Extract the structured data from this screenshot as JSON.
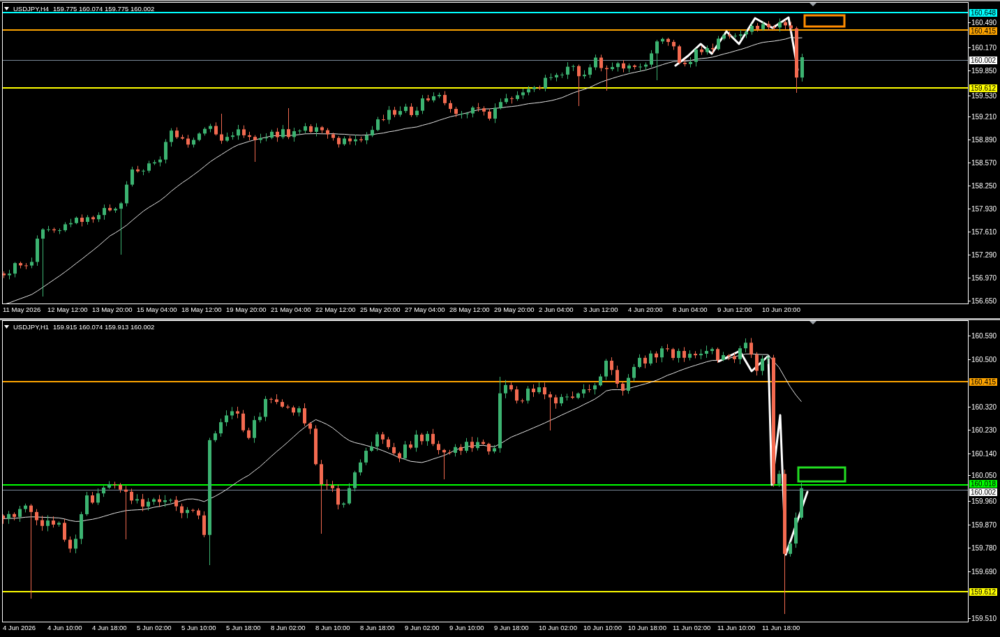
{
  "top_chart": {
    "header": {
      "symbol": "USDJPY,H4",
      "quote": "159.775 160.074 159.775 160.002"
    },
    "price_axis": [
      "160.490",
      "160.170",
      "159.850",
      "159.530",
      "159.210",
      "158.890",
      "158.570",
      "158.250",
      "157.930",
      "157.610",
      "157.290",
      "156.970",
      "156.650"
    ],
    "levels": [
      {
        "kind": "level",
        "price": "160.648",
        "color": "#00ffff"
      },
      {
        "kind": "level",
        "price": "160.415",
        "color": "#ffa500"
      },
      {
        "kind": "bid",
        "price": "160.002",
        "color": "#ffffff"
      },
      {
        "kind": "level",
        "price": "159.612",
        "color": "#ffff00"
      }
    ],
    "time_axis": [
      "11 May 2026",
      "12 May 12:00",
      "13 May 20:00",
      "15 May 04:00",
      "18 May 12:00",
      "19 May 20:00",
      "21 May 04:00",
      "22 May 12:00",
      "25 May 20:00",
      "27 May 04:00",
      "28 May 12:00",
      "29 May 20:00",
      "2 Jun 04:00",
      "3 Jun 12:00",
      "4 Jun 20:00",
      "8 Jun 04:00",
      "9 Jun 12:00",
      "10 Jun 20:00"
    ]
  },
  "bottom_chart": {
    "header": {
      "symbol": "USDJPY,H1",
      "quote": "159.915 160.074 159.913 160.002"
    },
    "price_axis": [
      "160.590",
      "160.500",
      "160.320",
      "160.230",
      "160.140",
      "160.050",
      "159.960",
      "159.870",
      "159.780",
      "159.690",
      "159.510"
    ],
    "levels": [
      {
        "kind": "level",
        "price": "160.415",
        "color": "#ffa500"
      },
      {
        "kind": "level",
        "price": "160.018",
        "color": "#00ff00"
      },
      {
        "kind": "bid",
        "price": "160.002",
        "color": "#ffffff"
      },
      {
        "kind": "level",
        "price": "159.612",
        "color": "#ffff00"
      }
    ],
    "time_axis": [
      "4 Jun 2026",
      "4 Jun 10:00",
      "4 Jun 18:00",
      "5 Jun 02:00",
      "5 Jun 10:00",
      "5 Jun 18:00",
      "8 Jun 02:00",
      "8 Jun 10:00",
      "8 Jun 18:00",
      "9 Jun 02:00",
      "9 Jun 10:00",
      "9 Jun 18:00",
      "10 Jun 02:00",
      "10 Jun 10:00",
      "10 Jun 18:00",
      "11 Jun 02:00",
      "11 Jun 10:00",
      "11 Jun 18:00"
    ]
  }
}
